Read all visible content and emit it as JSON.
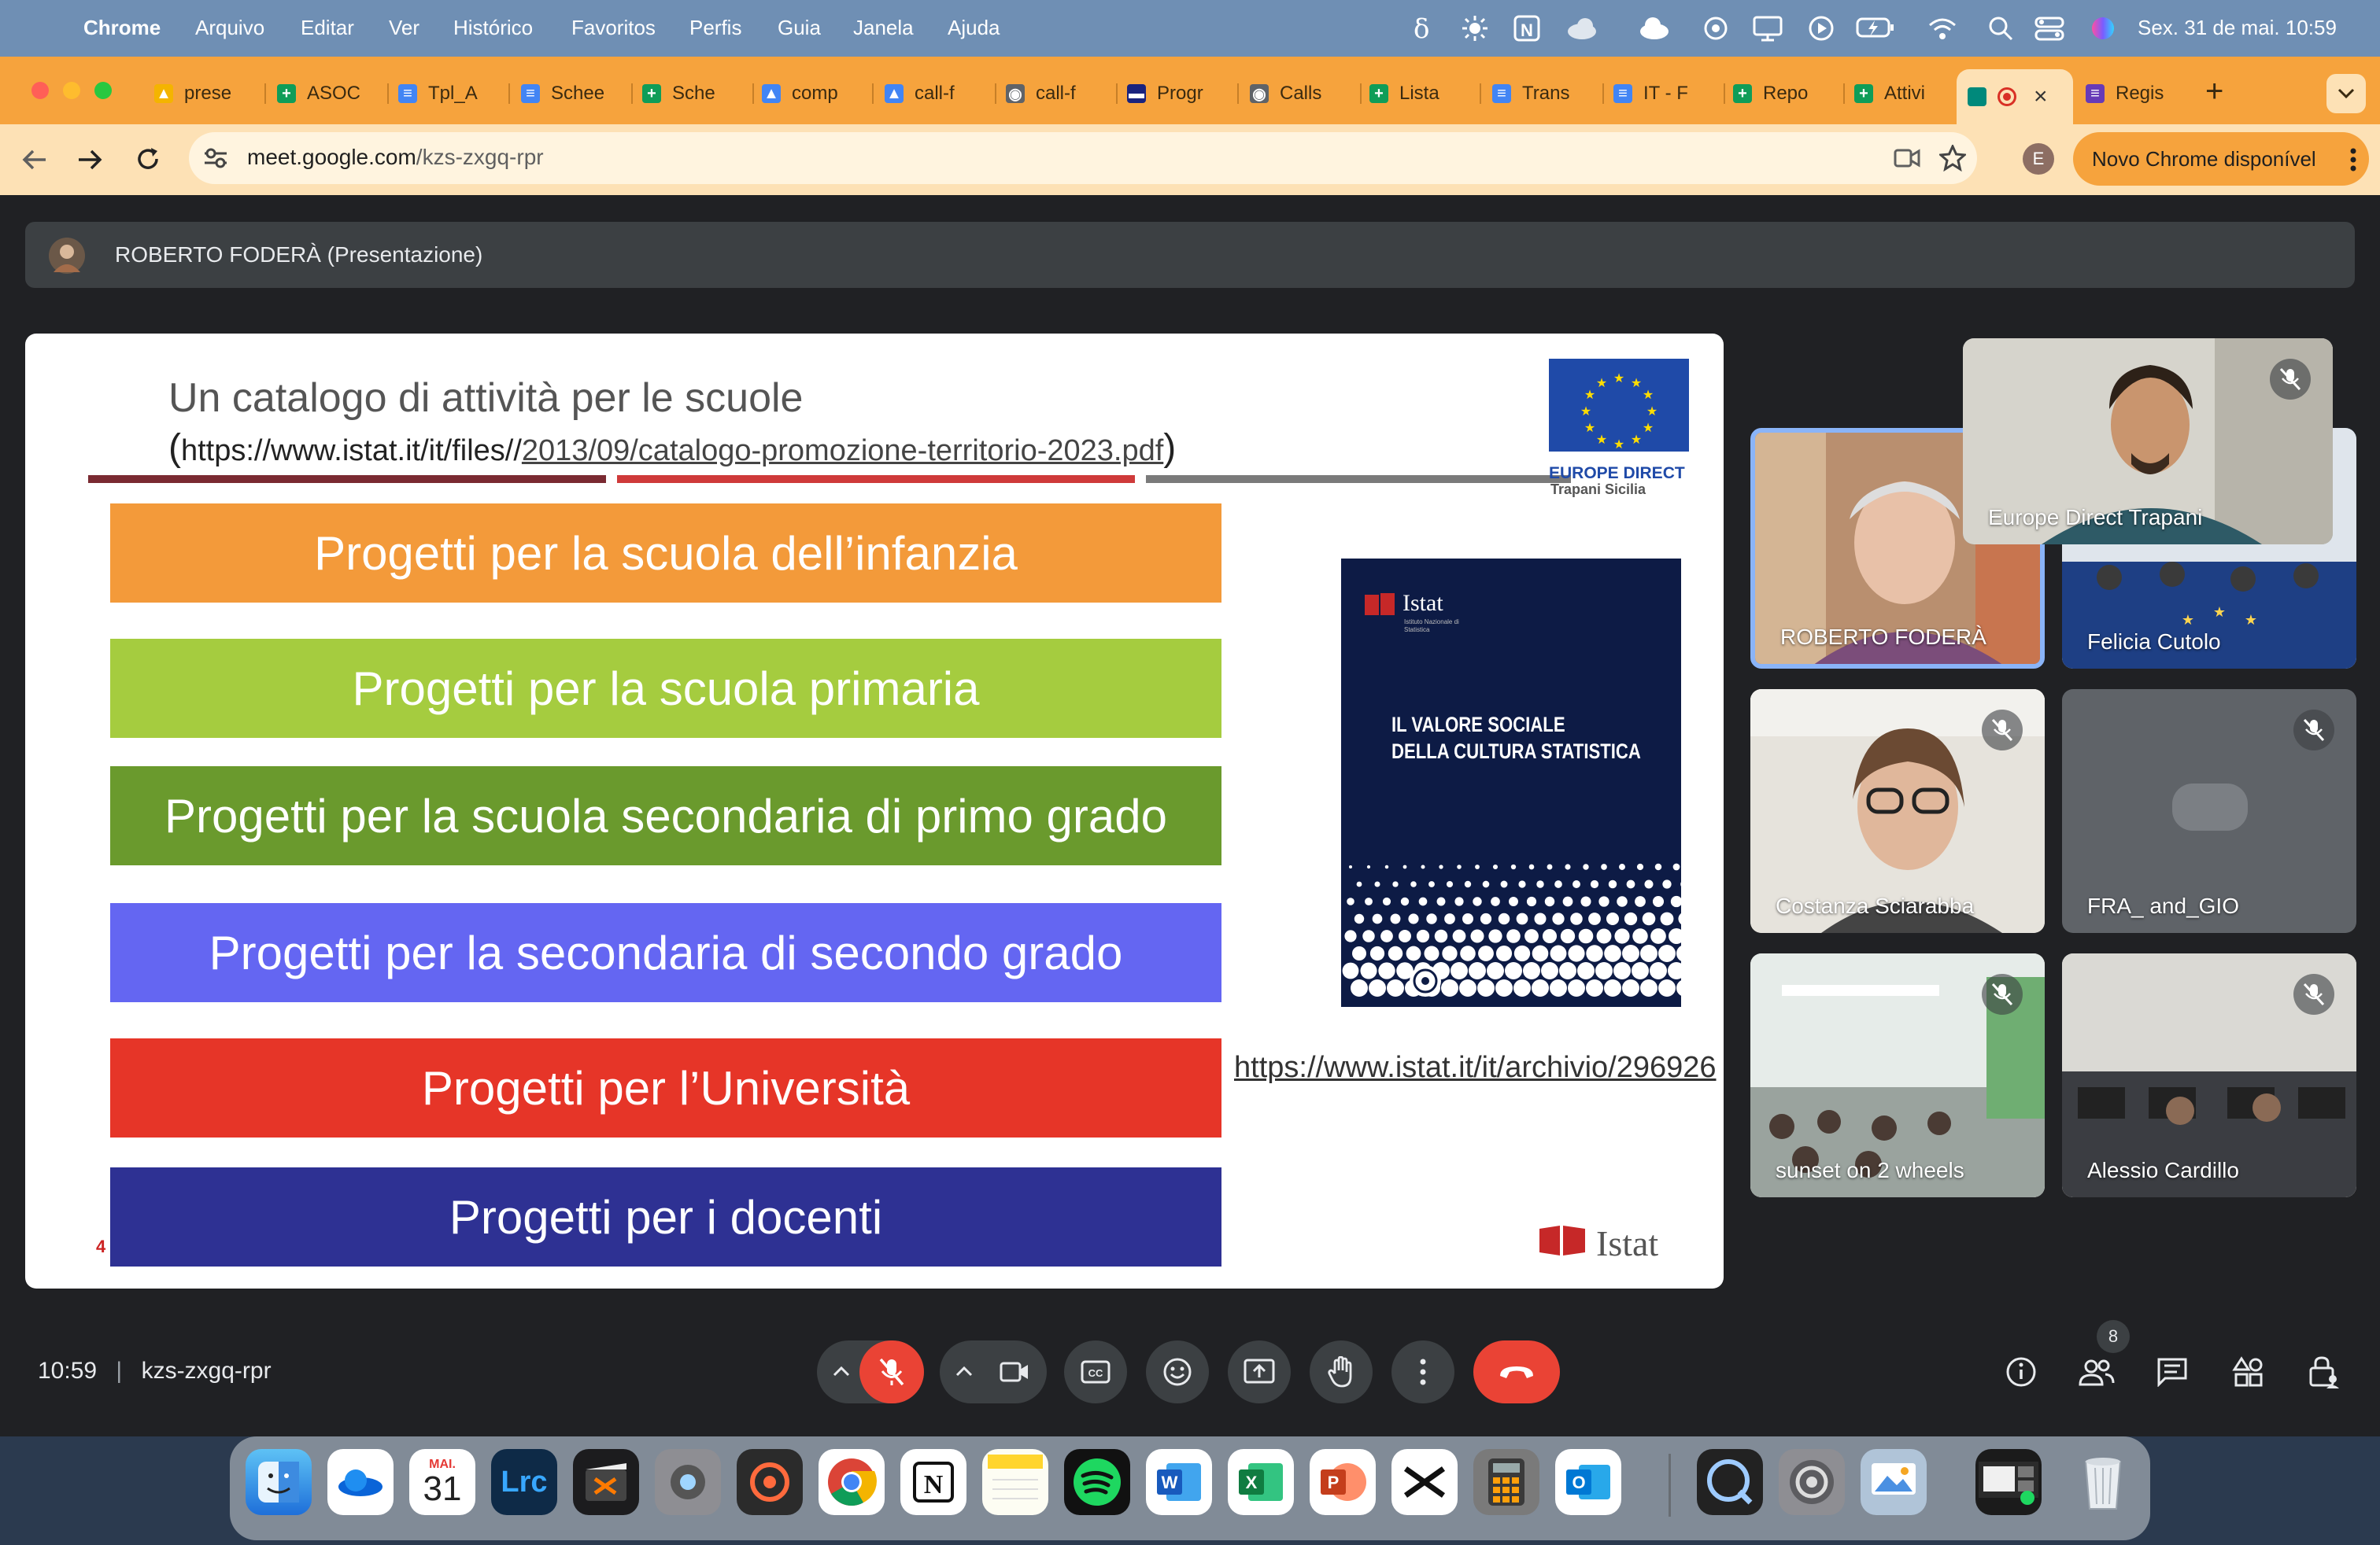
{
  "menubar": {
    "app_name": "Chrome",
    "items": [
      "Arquivo",
      "Editar",
      "Ver",
      "Histórico",
      "Favoritos",
      "Perfis",
      "Guia",
      "Janela",
      "Ajuda"
    ],
    "clock": "Sex. 31 de mai.  10:59"
  },
  "tabs": [
    {
      "title": "prese",
      "icon": "slides-icon",
      "color": "#f4b400"
    },
    {
      "title": "ASOC",
      "icon": "sheets-icon",
      "color": "#0f9d58"
    },
    {
      "title": "Tpl_A",
      "icon": "docs-icon",
      "color": "#4285f4"
    },
    {
      "title": "Schee",
      "icon": "docs-icon",
      "color": "#4285f4"
    },
    {
      "title": "Sche",
      "icon": "sheets-icon",
      "color": "#0f9d58"
    },
    {
      "title": "comp",
      "icon": "drive-icon",
      "color": "#4285f4"
    },
    {
      "title": "call-f",
      "icon": "drive-icon",
      "color": "#4285f4"
    },
    {
      "title": "call-f",
      "icon": "globe-icon",
      "color": "#5f6368"
    },
    {
      "title": "Progr",
      "icon": "site-icon",
      "color": "#1a237e"
    },
    {
      "title": "Calls",
      "icon": "globe-icon",
      "color": "#5f6368"
    },
    {
      "title": "Lista",
      "icon": "sheets-icon",
      "color": "#0f9d58"
    },
    {
      "title": "Trans",
      "icon": "docs-icon",
      "color": "#4285f4"
    },
    {
      "title": "IT - F",
      "icon": "docs-icon",
      "color": "#4285f4"
    },
    {
      "title": "Repo",
      "icon": "sheets-icon",
      "color": "#0f9d58"
    },
    {
      "title": "Attivi",
      "icon": "sheets-icon",
      "color": "#0f9d58"
    },
    {
      "title": "",
      "icon": "meet-icon",
      "color": "#00897b"
    },
    {
      "title": "Regis",
      "icon": "forms-icon",
      "color": "#673ab7"
    }
  ],
  "toolbar": {
    "url_domain": "meet.google.com",
    "url_path": "/kzs-zxgq-rpr",
    "profile_initial": "E",
    "update_label": "Novo Chrome disponível"
  },
  "presentation": {
    "presenter_label": "ROBERTO FODERÀ (Presentazione)"
  },
  "slide": {
    "title": "Un catalogo di attività per le scuole",
    "link_open": "(",
    "link_prefix": "https://www.istat.it/it/files//",
    "link_underlined": "2013/09/catalogo-promozione-territorio-2023.pdf",
    "link_close": ")",
    "europe_direct_title": "EUROPE DIRECT",
    "europe_direct_subtitle": "Trapani Sicilia",
    "bands": [
      {
        "label": "Progetti per la scuola dell’infanzia",
        "color": "#f39a3a"
      },
      {
        "label": "Progetti per la scuola primaria",
        "color": "#a5cc3f"
      },
      {
        "label": "Progetti per la scuola secondaria di primo grado",
        "color": "#6a9a2d"
      },
      {
        "label": "Progetti per la secondaria di secondo grado",
        "color": "#6466f2"
      },
      {
        "label": "Progetti per l’Università",
        "color": "#e63528"
      },
      {
        "label": "Progetti per i docenti",
        "color": "#2e3193"
      }
    ],
    "book": {
      "brand": "Istat",
      "brand_sub": "Istituto Nazionale di Statistica",
      "title_line1": "IL VALORE SOCIALE",
      "title_line2": "DELLA CULTURA STATISTICA"
    },
    "archive_link": "https://www.istat.it/it/archivio/296926",
    "page_number": "4",
    "footer_logo_text": "Istat"
  },
  "participants": [
    {
      "name": "Europe Direct Trapani",
      "muted": true
    },
    {
      "name": "ROBERTO FODERÀ",
      "muted": false,
      "speaking": true
    },
    {
      "name": "Felicia Cutolo",
      "muted": false
    },
    {
      "name": "Costanza Sciarabba",
      "muted": true
    },
    {
      "name": "FRA_ and_GIO",
      "muted": true
    },
    {
      "name": "sunset on 2 wheels",
      "muted": true
    },
    {
      "name": "Alessio Cardillo",
      "muted": true
    }
  ],
  "controls": {
    "time": "10:59",
    "separator": "|",
    "meeting_code": "kzs-zxgq-rpr",
    "participant_count": "8"
  },
  "dock": {
    "calendar_month": "MAI.",
    "calendar_day": "31",
    "lightroom_label": "Lrc"
  },
  "accent_colors": {
    "tabstrip": "#f6a33d",
    "toolbar": "#fde1b5",
    "leave_call": "#ea4335",
    "speaking_border": "#8ab4f8"
  }
}
